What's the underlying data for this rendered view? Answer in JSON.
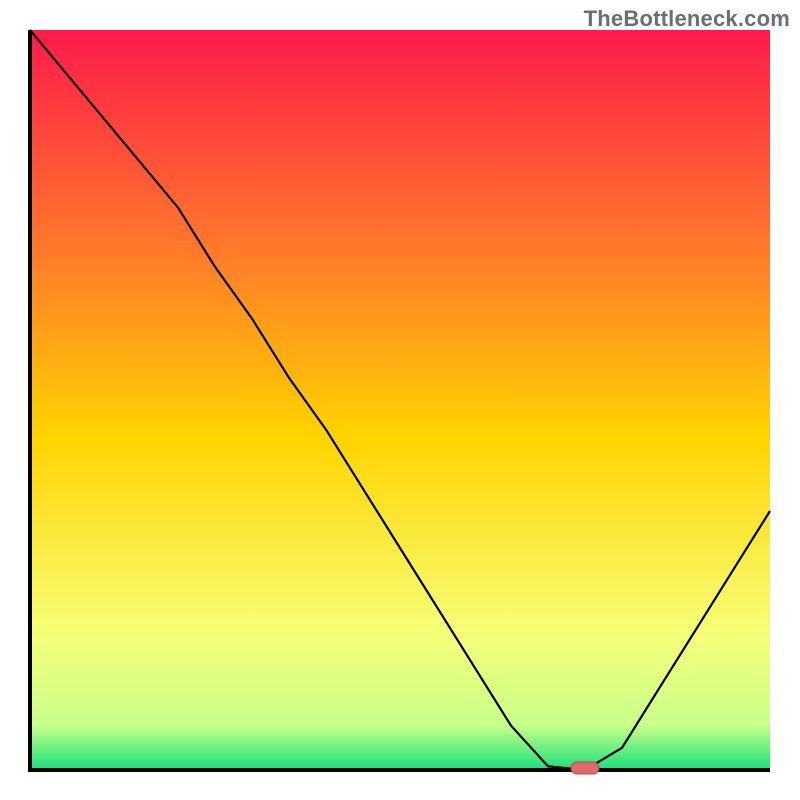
{
  "watermark": "TheBottleneck.com",
  "chart_data": {
    "type": "line",
    "title": "",
    "xlabel": "",
    "ylabel": "",
    "xlim": [
      0,
      100
    ],
    "ylim": [
      0,
      100
    ],
    "x": [
      0,
      5,
      10,
      15,
      20,
      25,
      30,
      35,
      40,
      45,
      50,
      55,
      60,
      65,
      70,
      75,
      80,
      85,
      90,
      95,
      100
    ],
    "values": [
      100,
      94,
      88,
      82,
      76,
      68,
      61,
      53,
      46,
      38,
      30,
      22,
      14,
      6,
      0.5,
      0,
      3,
      11,
      19,
      27,
      35
    ],
    "marker": {
      "x": 75,
      "y": 0
    },
    "colors": {
      "gradient_top": "#ff1a4b",
      "gradient_mid": "#ffd400",
      "gradient_low": "#f6ff7a",
      "gradient_bottom": "#18e07a",
      "axis": "#000000",
      "line": "#000000",
      "marker_fill": "#e06a6a"
    }
  }
}
